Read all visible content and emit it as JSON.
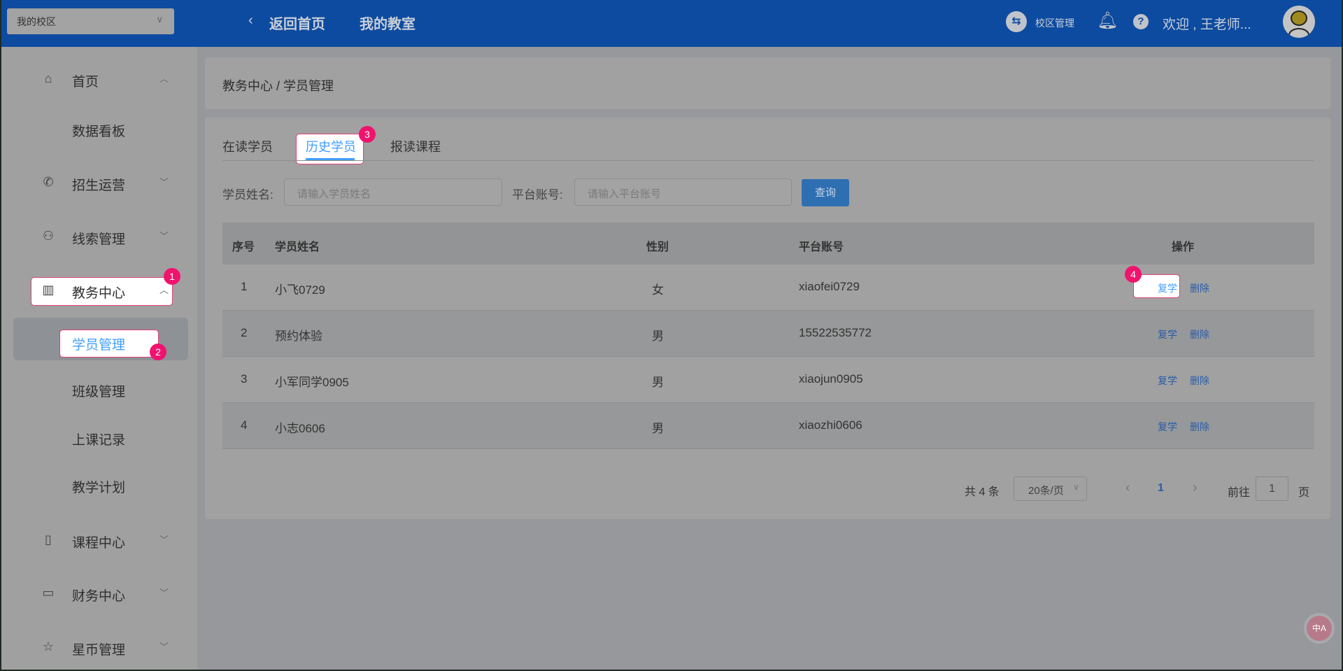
{
  "header": {
    "campus_select": "我的校区",
    "back_home": "返回首页",
    "my_classroom": "我的教室",
    "campus_manage": "校区管理",
    "welcome": "欢迎 , 王老师..."
  },
  "sidebar": {
    "items": [
      {
        "label": "首页",
        "icon": "home-icon",
        "expanded": true
      },
      {
        "label": "数据看板",
        "sub": true
      },
      {
        "label": "招生运营",
        "icon": "phone-icon"
      },
      {
        "label": "线索管理",
        "icon": "user-icon"
      },
      {
        "label": "教务中心",
        "icon": "building-icon",
        "expanded": true
      },
      {
        "label": "学员管理",
        "sub": true,
        "selected": true
      },
      {
        "label": "班级管理",
        "sub": true
      },
      {
        "label": "上课记录",
        "sub": true
      },
      {
        "label": "教学计划",
        "sub": true
      },
      {
        "label": "课程中心",
        "icon": "notebook-icon"
      },
      {
        "label": "财务中心",
        "icon": "card-icon"
      },
      {
        "label": "星币管理",
        "icon": "star-icon"
      }
    ]
  },
  "breadcrumb": "教务中心 / 学员管理",
  "tabs": [
    {
      "label": "在读学员"
    },
    {
      "label": "历史学员",
      "active": true
    },
    {
      "label": "报读课程"
    }
  ],
  "search": {
    "name_label": "学员姓名:",
    "name_placeholder": "请输入学员姓名",
    "account_label": "平台账号:",
    "account_placeholder": "请输入平台账号",
    "query_button": "查询"
  },
  "table": {
    "headers": [
      "序号",
      "学员姓名",
      "性别",
      "平台账号",
      "操作"
    ],
    "rows": [
      {
        "index": "1",
        "name": "小飞0729",
        "gender": "女",
        "account": "xiaofei0729"
      },
      {
        "index": "2",
        "name": "预约体验",
        "gender": "男",
        "account": "15522535772"
      },
      {
        "index": "3",
        "name": "小军同学0905",
        "gender": "男",
        "account": "xiaojun0905"
      },
      {
        "index": "4",
        "name": "小志0606",
        "gender": "男",
        "account": "xiaozhi0606"
      }
    ],
    "actions": {
      "resume": "复学",
      "delete": "删除"
    }
  },
  "pagination": {
    "total": "共 4 条",
    "page_size": "20条/页",
    "current": "1",
    "goto_label": "前往",
    "goto_value": "1",
    "page_suffix": "页"
  },
  "badges": [
    "1",
    "2",
    "3",
    "4"
  ],
  "colors": {
    "header": "#0d4ba0",
    "accent": "#409eff",
    "badge": "#f0136e"
  }
}
